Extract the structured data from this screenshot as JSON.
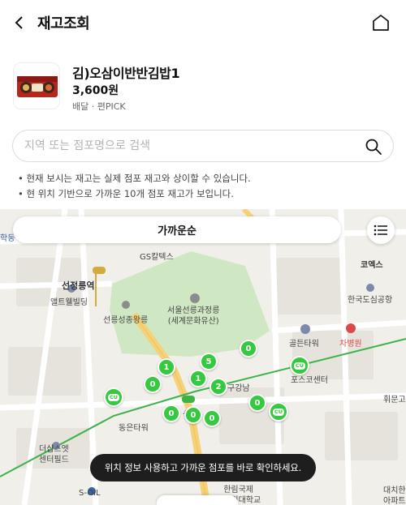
{
  "header": {
    "title": "재고조회",
    "back_icon": "chevron-left-icon",
    "home_icon": "home-icon"
  },
  "product": {
    "name": "김)오삼이반반김밥1",
    "price": "3,600원",
    "tags": "배달 · 편PICK"
  },
  "search": {
    "placeholder": "지역 또는 점포명으로 검색",
    "value": "",
    "icon": "search-icon"
  },
  "notices": [
    "• 현재 보시는 재고는 실제 점포 재고와 상이할 수 있습니다.",
    "• 현 위치 기반으로 가까운 10개 점포 재고가 보입니다."
  ],
  "map": {
    "sort_label": "가까운순",
    "list_icon": "list-icon",
    "labels": {
      "hakdong": "학동",
      "gs_tower": "GS칼텍스",
      "koex": "코엑스",
      "seonjeongneung": "선정릉역",
      "altwell": "앨트웰빌딩",
      "airport_terminal": "한국도심공항",
      "royal_tomb": "선릉성종왕릉",
      "heritage_1": "서울선릉과정릉",
      "heritage_2": "(세계문화유산)",
      "golden_tower": "골든타워",
      "cha_hospital": "차병원",
      "posco": "포스코센터",
      "gangnam": "구강남",
      "dongeun": "동은타워",
      "hwimun": "휘문고",
      "thesharp_1": "더샵스엣",
      "thesharp_2": "센터필드",
      "hanrim_1": "한림국제",
      "hanrim_2": "대학원대학교",
      "soil": "S-OIL",
      "daechi_1": "대치한",
      "daechi_2": "아파트",
      "station_suffix": "선"
    },
    "markers": [
      {
        "count": "1"
      },
      {
        "count": "5"
      },
      {
        "count": "0"
      },
      {
        "count": "0"
      },
      {
        "count": "1"
      },
      {
        "count": "2"
      },
      {
        "count": "0"
      },
      {
        "count": "0"
      },
      {
        "count": "0"
      },
      {
        "count": "0"
      }
    ],
    "cu_logo": "CU",
    "colors": {
      "marker": "#35c940",
      "park": "#cfe8c3",
      "road_main": "#f5d27a",
      "subway": "#3bb34a",
      "toast_bg": "#1e1e1e"
    }
  },
  "toast": {
    "message": "위치 정보 사용하고 가까운 점포를 바로 확인하세요."
  }
}
